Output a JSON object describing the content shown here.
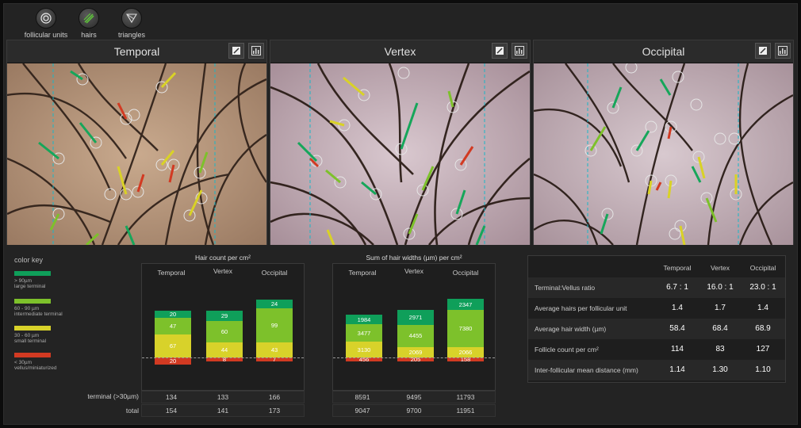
{
  "toolbar": {
    "follicular_units": "follicular units",
    "hairs": "hairs",
    "triangles": "triangles"
  },
  "panels": [
    {
      "title": "Temporal"
    },
    {
      "title": "Vertex"
    },
    {
      "title": "Occipital"
    }
  ],
  "color_key": {
    "title": "color key",
    "items": [
      {
        "line1": "> 90µm",
        "line2": "large terminal",
        "color": "#0f9f5a"
      },
      {
        "line1": "60 - 90 µm",
        "line2": "intermediate terminal",
        "color": "#7dc12b"
      },
      {
        "line1": "30 - 60 µm",
        "line2": "small terminal",
        "color": "#d8d22a"
      },
      {
        "line1": "< 30µm",
        "line2": "vellus/miniaturized",
        "color": "#d23a22"
      }
    ]
  },
  "hair_count": {
    "title": "Hair count per cm²",
    "columns": [
      "Temporal",
      "Vertex",
      "Occipital"
    ],
    "bars": [
      {
        "large": "20",
        "intermediate": "47",
        "small": "67",
        "vellus": "20"
      },
      {
        "large": "29",
        "intermediate": "60",
        "small": "44",
        "vellus": "8"
      },
      {
        "large": "24",
        "intermediate": "99",
        "small": "43",
        "vellus": "7"
      }
    ],
    "terminal_label": "terminal (>30µm)",
    "total_label": "total",
    "terminal": [
      "134",
      "133",
      "166"
    ],
    "total": [
      "154",
      "141",
      "173"
    ]
  },
  "hair_widths": {
    "title": "Sum of hair widths (µm) per cm²",
    "columns": [
      "Temporal",
      "Vertex",
      "Occipital"
    ],
    "bars": [
      {
        "large": "1984",
        "intermediate": "3477",
        "small": "3130",
        "vellus": "456"
      },
      {
        "large": "2971",
        "intermediate": "4455",
        "small": "2069",
        "vellus": "205"
      },
      {
        "large": "2347",
        "intermediate": "7380",
        "small": "2066",
        "vellus": "158"
      }
    ],
    "terminal": [
      "8591",
      "9495",
      "11793"
    ],
    "total": [
      "9047",
      "9700",
      "11951"
    ]
  },
  "metrics": {
    "columns": [
      "Temporal",
      "Vertex",
      "Occipital"
    ],
    "rows": [
      {
        "label": "Terminal:Vellus ratio",
        "values": [
          "6.7 : 1",
          "16.0 : 1",
          "23.0 : 1"
        ]
      },
      {
        "label": "Average hairs per follicular unit",
        "values": [
          "1.4",
          "1.7",
          "1.4"
        ]
      },
      {
        "label": "Average hair width (µm)",
        "values": [
          "58.4",
          "68.4",
          "68.9"
        ]
      },
      {
        "label": "Follicle count per cm²",
        "values": [
          "114",
          "83",
          "127"
        ]
      },
      {
        "label": "Inter-follicular mean distance (mm)",
        "values": [
          "1.14",
          "1.30",
          "1.10"
        ]
      }
    ]
  }
}
